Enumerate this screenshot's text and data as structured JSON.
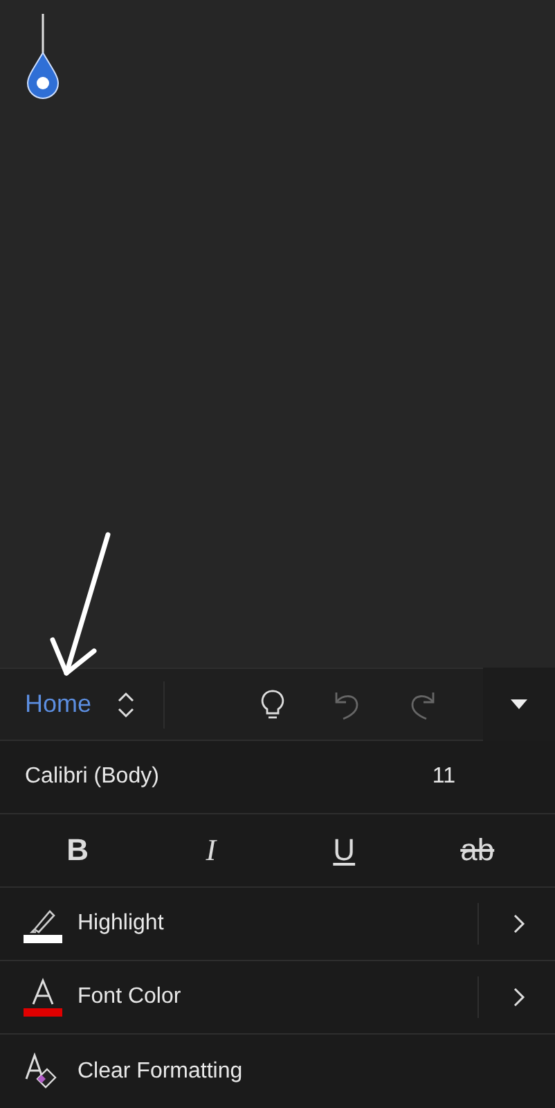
{
  "toolbar": {
    "tab": "Home",
    "undo": {
      "disabled": true
    },
    "redo": {
      "disabled": true
    }
  },
  "font": {
    "name": "Calibri (Body)",
    "size": "11"
  },
  "styles": [
    {
      "label": "B",
      "kind": "bold"
    },
    {
      "label": "I",
      "kind": "italic"
    },
    {
      "label": "U",
      "kind": "underline"
    },
    {
      "label": "ab",
      "kind": "strike"
    }
  ],
  "rows": [
    {
      "label": "Highlight",
      "kind": "highlight",
      "color": "#ffffff",
      "submenu": true
    },
    {
      "label": "Font Color",
      "kind": "fontcolor",
      "color": "#e00000",
      "submenu": true
    },
    {
      "label": "Clear Formatting",
      "kind": "clear",
      "submenu": false
    }
  ]
}
